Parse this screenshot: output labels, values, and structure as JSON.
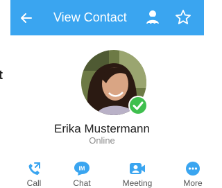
{
  "header": {
    "back_icon": "arrow-left-icon",
    "title": "View Contact",
    "agent_icon": "agent-icon",
    "favorite_icon": "star-outline-icon",
    "background": "#3aa5f0"
  },
  "edge_text": "t",
  "contact": {
    "name": "Erika Mustermann",
    "status": "Online",
    "status_color": "#3fbf4e",
    "avatar_icon": "contact-photo"
  },
  "actions": [
    {
      "label": "Call",
      "icon": "phone-icon"
    },
    {
      "label": "Chat",
      "icon": "im-chat-icon",
      "icon_text": "IM"
    },
    {
      "label": "Meeting",
      "icon": "video-meeting-icon"
    },
    {
      "label": "More",
      "icon": "more-dots-icon"
    }
  ],
  "colors": {
    "accent": "#3aa5f0",
    "text": "#222222",
    "muted": "#8c8c8c"
  }
}
